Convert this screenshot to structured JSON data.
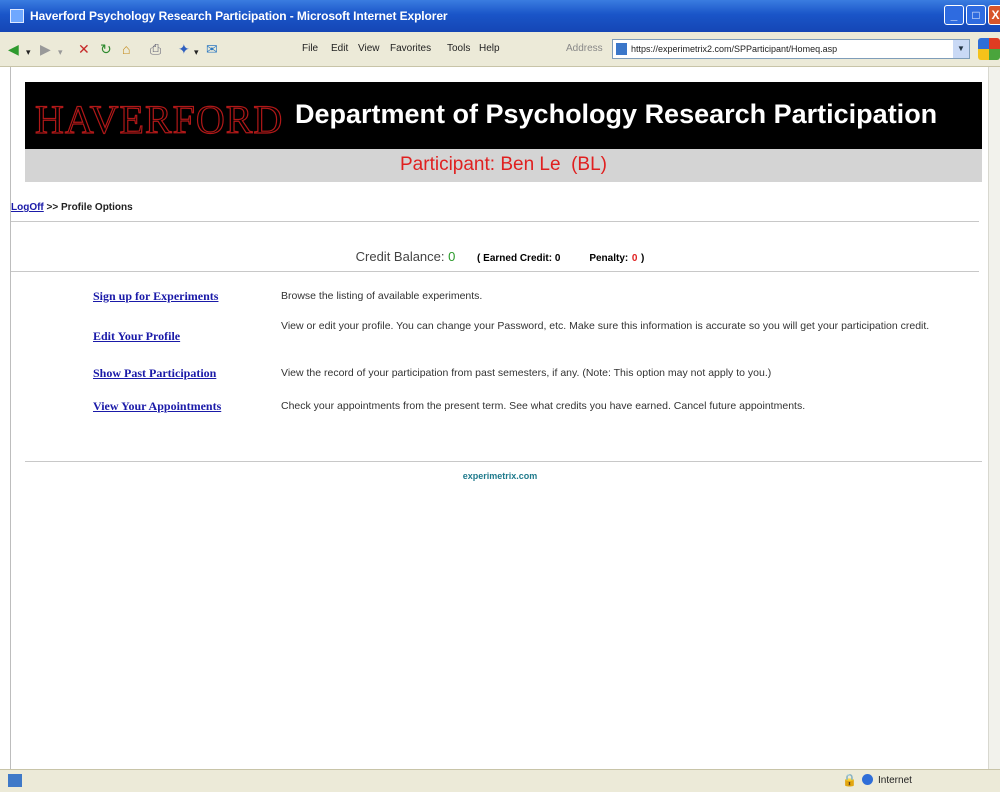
{
  "window": {
    "title": "Haverford Psychology Research Participation - Microsoft Internet Explorer",
    "min_symbol": "_",
    "max_symbol": "□",
    "close_symbol": "X"
  },
  "toolbar": {
    "menu": [
      "File",
      "Edit",
      "View",
      "Favorites",
      "Tools",
      "Help"
    ],
    "address_label": "Address",
    "url": "https://experimetrix2.com/SPParticipant/Homeq.asp"
  },
  "header": {
    "logo": "HAVERFORD",
    "title": "Department of Psychology Research Participation",
    "participant": "Participant: Ben Le  (BL)"
  },
  "breadcrumb": {
    "logoff": "LogOff",
    "separator": " >> ",
    "current": "Profile Options"
  },
  "credit": {
    "balance_label": "Credit Balance:",
    "balance_value": "0",
    "earned_label": "( Earned Credit: 0",
    "penalty_label": "Penalty:",
    "penalty_value": "0",
    "close_paren": ")"
  },
  "options": [
    {
      "label": "Sign up for Experiments",
      "desc": "Browse the listing of available experiments."
    },
    {
      "label": "Edit Your Profile",
      "desc": "View or edit your profile. You can change your Password, etc. Make sure this information is accurate so you will get your participation credit."
    },
    {
      "label": "Show Past Participation",
      "desc": "View the record of your participation from past semesters, if any. (Note: This option may not apply to you.)"
    },
    {
      "label": "View Your Appointments",
      "desc": "Check your appointments from the present term. See what credits you have earned. Cancel future appointments."
    }
  ],
  "footer": {
    "link": "experimetrix.com"
  },
  "statusbar": {
    "zone": "Internet"
  },
  "colors": {
    "titlebar": "#1a55c8",
    "link": "#1a1aa8",
    "participant_text": "#e02020",
    "balance_value": "#2a9a2a"
  }
}
